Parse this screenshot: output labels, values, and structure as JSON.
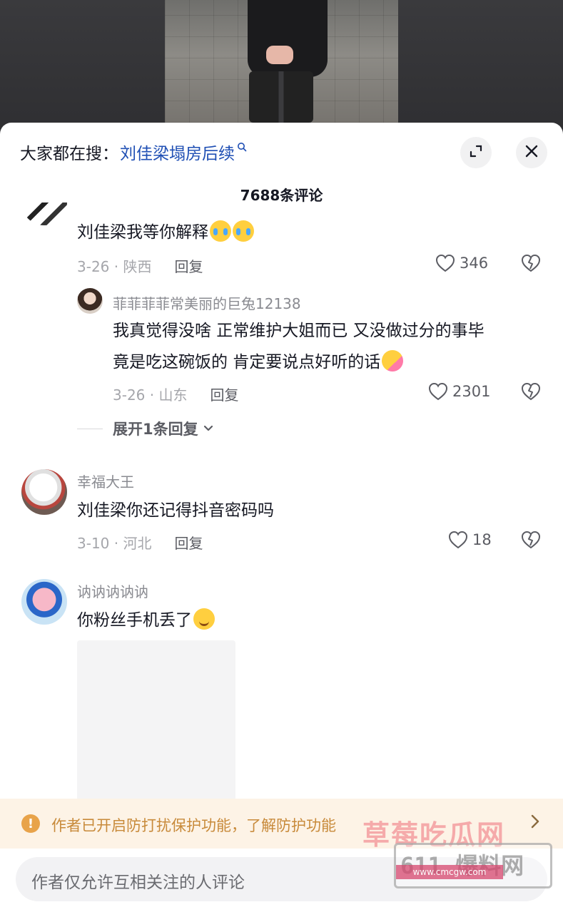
{
  "search_hint": {
    "prefix": "大家都在搜：",
    "term": "刘佳梁塌房后续"
  },
  "comment_count": "7688条评论",
  "comments": [
    {
      "content": "刘佳梁我等你解释",
      "date_location": "3-26 · 陕西",
      "reply_label": "回复",
      "likes": "346"
    },
    {
      "username": "菲菲菲菲常美丽的巨兔12138",
      "content_line1": "我真觉得没啥 正常维护大姐而已 又没做过分的事毕",
      "content_line2": "竟是吃这碗饭的 肯定要说点好听的话",
      "date_location": "3-26 · 山东",
      "reply_label": "回复",
      "likes": "2301"
    },
    {
      "username": "幸福大王",
      "content": "刘佳梁你还记得抖音密码吗",
      "date_location": "3-10 · 河北",
      "reply_label": "回复",
      "likes": "18"
    },
    {
      "username": "讷讷讷讷讷",
      "content": "你粉丝手机丢了"
    }
  ],
  "expand_replies": "展开1条回复",
  "notice": {
    "text": "作者已开启防打扰保护功能，了解防护功能"
  },
  "input": {
    "placeholder": "作者仅允许互相关注的人评论"
  },
  "watermark": {
    "text": "草莓吃瓜网",
    "badge": "611 爆料网",
    "site": "www.cmcgw.com"
  },
  "colors": {
    "link": "#1f4fb4",
    "notice_bg": "#fdf3e6",
    "notice_text": "#c88a3a"
  },
  "icons": [
    "search-icon",
    "expand-icon",
    "close-icon",
    "heart-icon",
    "broken-heart-icon",
    "warning-icon",
    "chevron-right-icon",
    "chevron-down-icon"
  ]
}
